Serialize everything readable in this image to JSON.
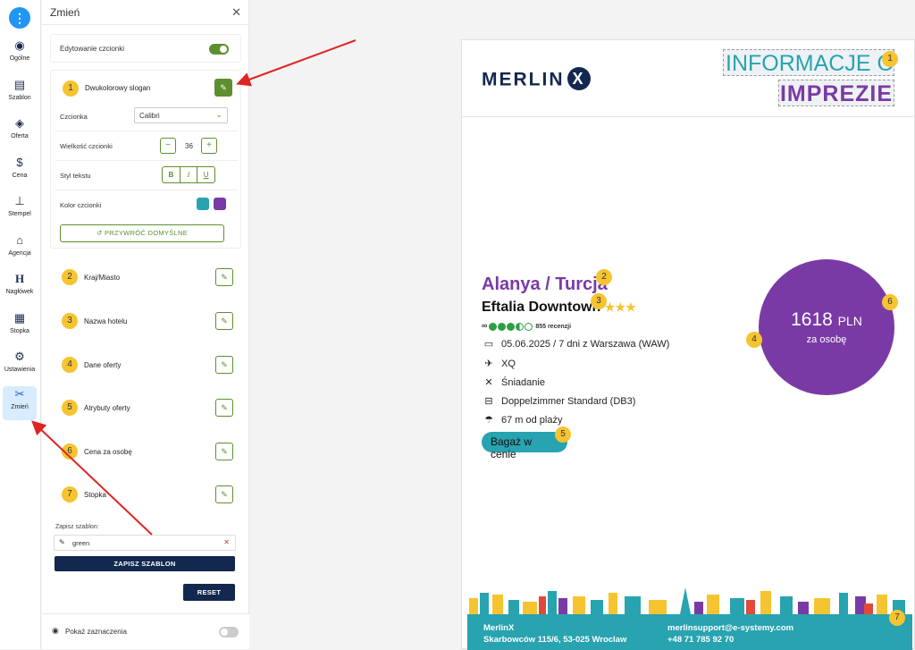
{
  "rail": {
    "items": [
      {
        "label": "Ogólne",
        "icon": "eye-icon"
      },
      {
        "label": "Szablon",
        "icon": "layout-icon"
      },
      {
        "label": "Oferta",
        "icon": "layers-icon"
      },
      {
        "label": "Cena",
        "icon": "money-bag-icon"
      },
      {
        "label": "Stempel",
        "icon": "stamp-icon"
      },
      {
        "label": "Agencja",
        "icon": "home-icon"
      },
      {
        "label": "Nagłówek",
        "icon": "heading-icon"
      },
      {
        "label": "Stopka",
        "icon": "footer-grid-icon"
      },
      {
        "label": "Ustawienia",
        "icon": "gear-icon"
      },
      {
        "label": "Zmień",
        "icon": "tools-icon"
      }
    ]
  },
  "panel": {
    "title": "Zmień",
    "edit_fonts_label": "Edytowanie czcionki",
    "section1": {
      "number": "1",
      "label": "Dwukolorowy slogan",
      "font_label": "Czcionka",
      "font_value": "Calibri",
      "size_label": "Wielkość czcionki",
      "size_value": "36",
      "style_label": "Styl tekstu",
      "style_bold": "B",
      "style_italic": "I",
      "style_underline": "U",
      "color_label": "Kolor czcionki",
      "color1": "#28a3b0",
      "color2": "#7a3aa6",
      "restore_label": "PRZYWRÓĆ DOMYŚLNE"
    },
    "items": [
      {
        "number": "2",
        "label": "Kraj/Miasto"
      },
      {
        "number": "3",
        "label": "Nazwa hotelu"
      },
      {
        "number": "4",
        "label": "Dane oferty"
      },
      {
        "number": "5",
        "label": "Atrybuty oferty"
      },
      {
        "number": "6",
        "label": "Cena za osobę"
      },
      {
        "number": "7",
        "label": "Stopka"
      }
    ],
    "save_template_label": "Zapisz szablon:",
    "save_template_value": "green",
    "save_template_button": "ZAPISZ SZABLON",
    "reset_button": "RESET",
    "show_selection_label": "Pokaż zaznaczenia"
  },
  "preview": {
    "logo_text": "MERLIN",
    "logo_x": "X",
    "slogan_line1": "INFORMACJE O",
    "slogan_line2": "IMPREZIE",
    "destination": "Alanya / Turcja",
    "hotel_name": "Eftalia Downtown",
    "hotel_stars": "★★★",
    "reviews": "855 recenzji",
    "date_info": "05.06.2025 / 7 dni z Warszawa (WAW)",
    "flight": "XQ",
    "board": "Śniadanie",
    "room": "Doppelzimmer Standard (DB3)",
    "beach": "67 m od plaży",
    "badge": "Bagaż w cenie",
    "price_value": "1618",
    "price_currency": "PLN",
    "price_unit": "za osobę",
    "footer_name": "MerlinX",
    "footer_address": "Skarbowców 115/6, 53-025 Wroclaw",
    "footer_email": "merlinsupport@e-systemy.com",
    "footer_phone": "+48 71 785 92 70",
    "markers": [
      "1",
      "2",
      "3",
      "4",
      "5",
      "6",
      "7"
    ]
  },
  "colors": {
    "accent_green": "#5d8f2e",
    "teal": "#28a3b0",
    "purple": "#7a3aa6",
    "navy": "#13284f",
    "marker_yellow": "#f6c431"
  }
}
